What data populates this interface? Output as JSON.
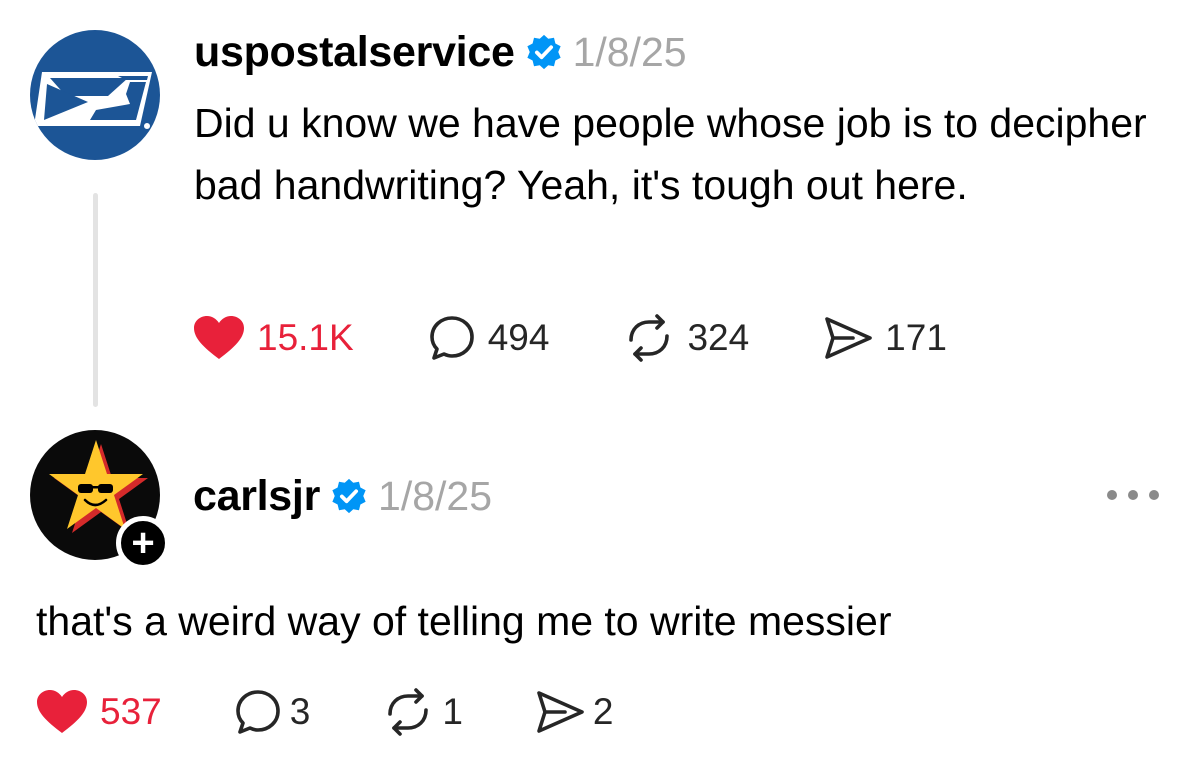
{
  "posts": [
    {
      "username": "uspostalservice",
      "verified": true,
      "date": "1/8/25",
      "text": "Did u know we have people whose job is to decipher bad handwriting? Yeah, it's tough out here.",
      "stats": {
        "likes": "15.1K",
        "replies": "494",
        "reposts": "324",
        "shares": "171"
      },
      "liked": true
    },
    {
      "username": "carlsjr",
      "verified": true,
      "date": "1/8/25",
      "text": "that's a weird way of telling me to write messier",
      "stats": {
        "likes": "537",
        "replies": "3",
        "reposts": "1",
        "shares": "2"
      },
      "liked": true,
      "follow_badge": "+"
    }
  ],
  "colors": {
    "like_red": "#e8213a",
    "verified_blue": "#0095f6",
    "muted_gray": "#a6a6a6",
    "usps_blue": "#1c5596",
    "carls_yellow": "#ffc72c"
  },
  "icons": [
    "heart-icon",
    "comment-icon",
    "repost-icon",
    "share-icon",
    "verified-badge-icon",
    "more-icon",
    "plus-icon"
  ]
}
